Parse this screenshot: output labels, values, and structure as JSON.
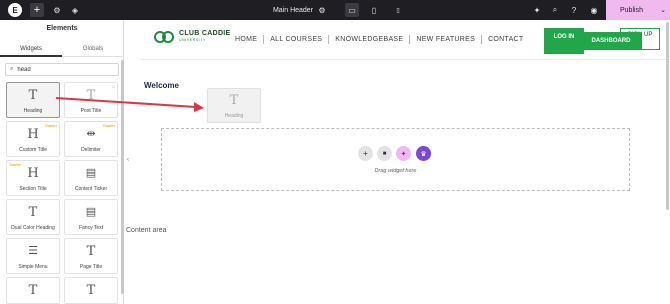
{
  "topbar": {
    "logo_glyph": "E",
    "add_glyph": "+",
    "settings_glyph": "⚙",
    "layers_glyph": "◈",
    "document_title": "Main Header",
    "doc_settings_glyph": "⚙",
    "desktop_glyph": "▭",
    "tablet_glyph": "▯",
    "mobile_glyph": "▯",
    "ai_glyph": "✦",
    "search_glyph": "⌕",
    "help_glyph": "?",
    "preview_glyph": "◉",
    "publish_label": "Publish",
    "publish_chevron": "⌄"
  },
  "sidebar": {
    "title": "Elements",
    "tabs": [
      "Widgets",
      "Globals"
    ],
    "search_value": "head",
    "search_glyph": "⌕",
    "widgets": [
      {
        "label": "Heading",
        "icon": "T",
        "selected": true
      },
      {
        "label": "Post Title",
        "icon": "T",
        "pro": true
      },
      {
        "label": "Custom Title",
        "icon": "H",
        "badge": "Starter"
      },
      {
        "label": "Delimiter",
        "icon": "⇹",
        "badge": "Starter"
      },
      {
        "label": "Section Title",
        "icon": "H",
        "badge": "Starter"
      },
      {
        "label": "Content Ticker",
        "icon": "▤"
      },
      {
        "label": "Dual Color Heading",
        "icon": "T"
      },
      {
        "label": "Fancy Text",
        "icon": "▤"
      },
      {
        "label": "Simple Menu",
        "icon": "☰"
      },
      {
        "label": "Page Title",
        "icon": "T"
      },
      {
        "label": "",
        "icon": "T"
      },
      {
        "label": "",
        "icon": "T"
      }
    ],
    "collapse_glyph": "‹"
  },
  "site_header": {
    "brand_line1": "CLUB CADDIE",
    "brand_line2": "UNIVERSITY",
    "nav": [
      "HOME",
      "ALL COURSES",
      "KNOWLEDGEBASE",
      "NEW FEATURES",
      "CONTACT"
    ],
    "login_label": "LOG IN",
    "dashboard_label": "DASHBOARD",
    "signup_label": "SIGN UP"
  },
  "canvas": {
    "welcome": "Welcome",
    "ghost_icon": "T",
    "ghost_label": "Heading",
    "drop_add": "+",
    "drop_folder": "■",
    "drop_ai": "✦",
    "drop_kit": "♛",
    "drop_text": "Drag widget here",
    "content_area": "Content area"
  },
  "colors": {
    "topbar": "#1f1f23",
    "publish": "#f0b9f0",
    "brand_green": "#22a64a",
    "arrow": "#d63a4a"
  }
}
